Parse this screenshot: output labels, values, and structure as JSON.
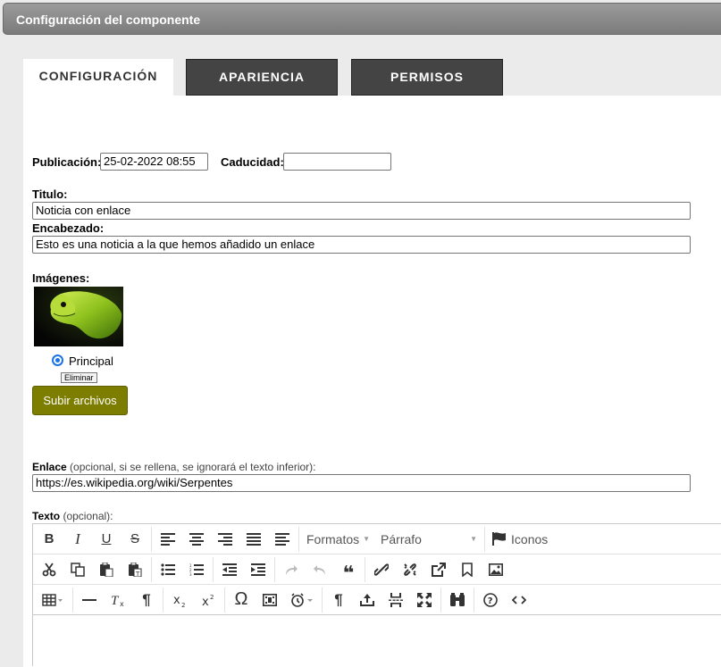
{
  "window": {
    "title": "Configuración del componente"
  },
  "tabs": [
    {
      "label": "CONFIGURACIÓN",
      "active": true
    },
    {
      "label": "APARIENCIA",
      "active": false
    },
    {
      "label": "PERMISOS",
      "active": false
    }
  ],
  "form": {
    "publicacion": {
      "label": "Publicación:",
      "value": "25-02-2022 08:55"
    },
    "caducidad": {
      "label": "Caducidad:",
      "value": ""
    },
    "titulo": {
      "label": "Titulo:",
      "value": "Noticia con enlace"
    },
    "encabezado": {
      "label": "Encabezado:",
      "value": "Esto es una noticia a la que hemos añadido un enlace"
    },
    "imagenes": {
      "label": "Imágenes:",
      "principal_label": "Principal",
      "principal_checked": true,
      "delete_label": "Eliminar",
      "upload_label": "Subir archivos"
    },
    "enlace": {
      "label": "Enlace",
      "note": " (opcional, si se rellena, se ignorará el texto inferior):",
      "value": "https://es.wikipedia.org/wiki/Serpentes"
    },
    "texto": {
      "label": "Texto",
      "note": " (opcional):"
    }
  },
  "editor": {
    "formats_label": "Formatos",
    "block_label": "Párrafo",
    "icons_label": "Iconos",
    "bold": "B",
    "italic": "I",
    "underline": "U",
    "strike": "S",
    "omega": "Ω",
    "pilcrow": "¶",
    "quote": "❝",
    "colors": {
      "toolbar_icon": "#333333",
      "accent": "#7d7d00",
      "radio": "#1a73e8"
    }
  }
}
